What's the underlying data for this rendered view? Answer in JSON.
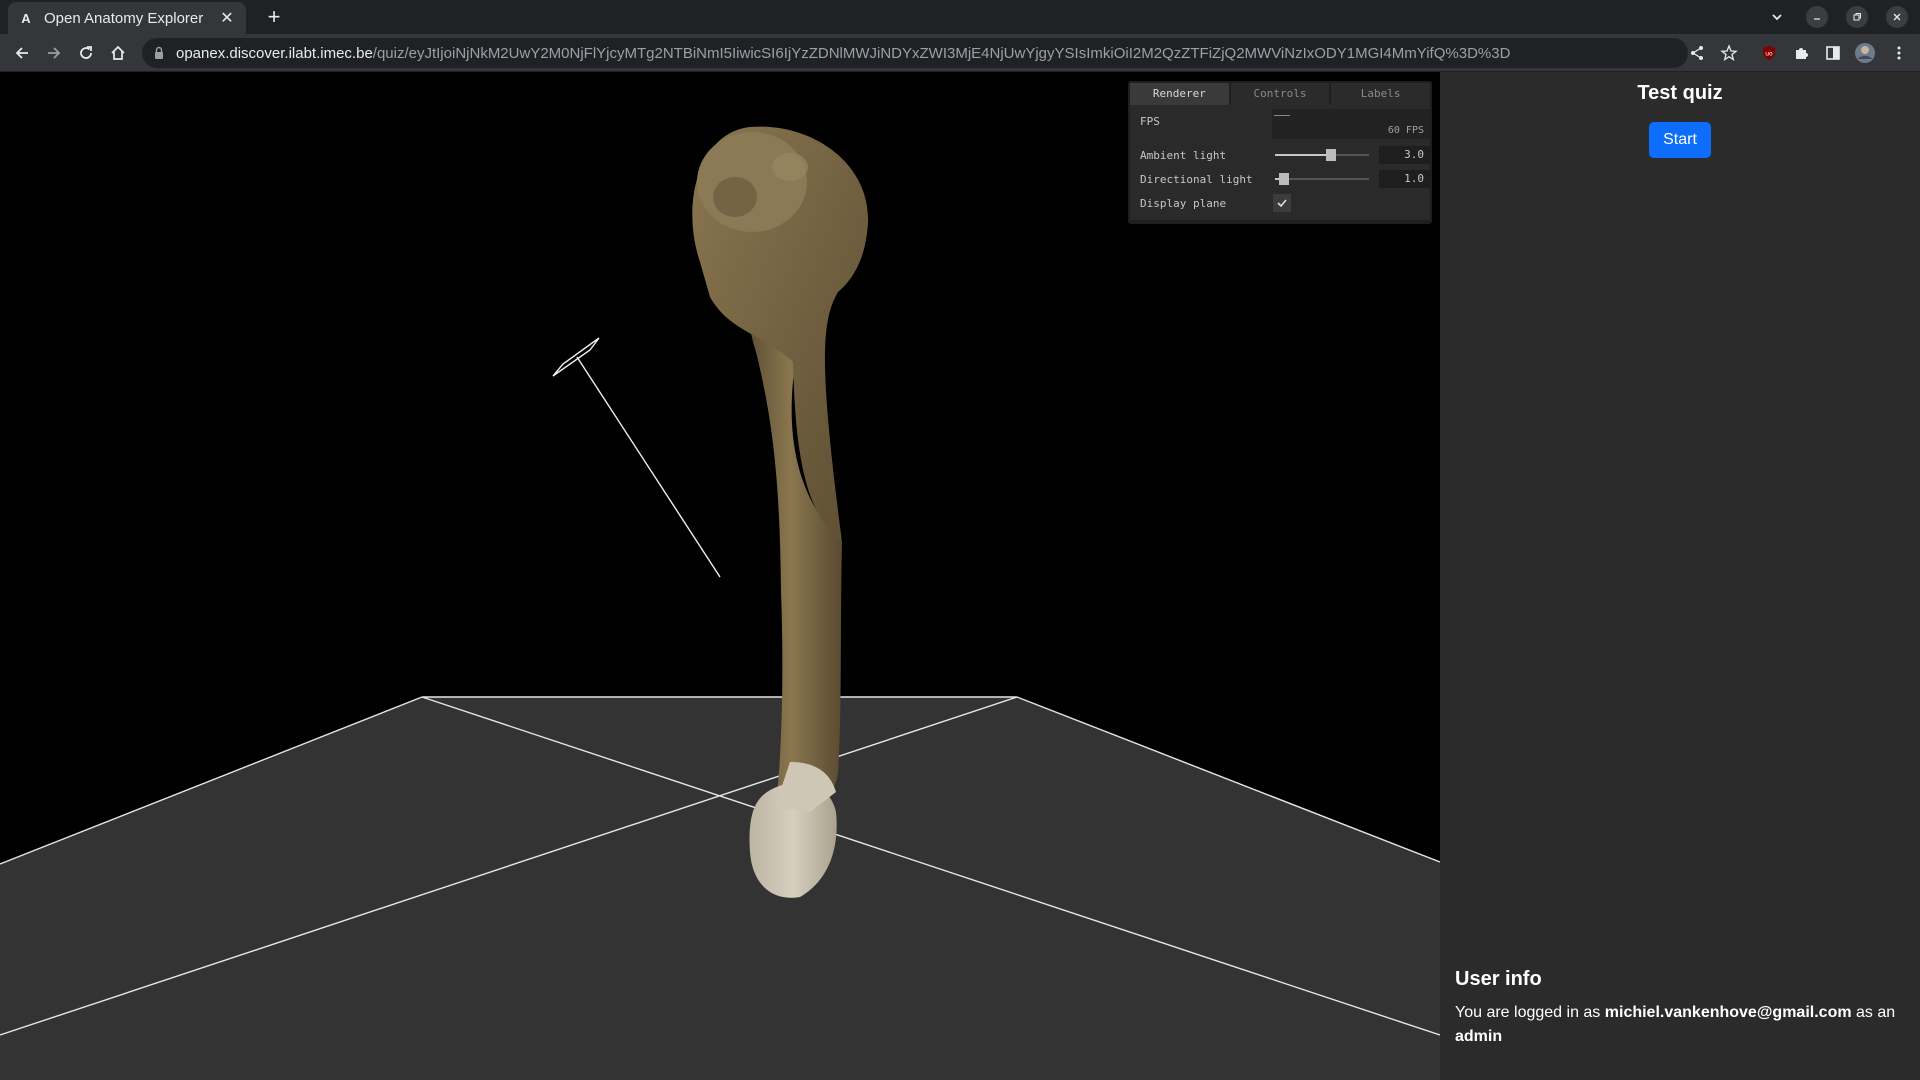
{
  "browser": {
    "tab_title": "Open Anatomy Explorer",
    "tab_favicon": "A",
    "close_glyph": "✕",
    "newtab_glyph": "+",
    "url_host": "opanex.discover.ilabt.imec.be",
    "url_path": "/quiz/eyJtIjoiNjNkM2UwY2M0NjFlYjcyMTg2NTBiNmI5IiwicSI6IjYzZDNlMWJiNDYxZWI3MjE4NjUwYjgyYSIsImkiOiI2M2QzZTFiZjQ2MWViNzIxODY1MGI4MmYifQ%3D%3D"
  },
  "gui": {
    "tabs": [
      "Renderer",
      "Controls",
      "Labels"
    ],
    "active_tab": "Renderer",
    "fps_label": "FPS",
    "fps_value": "60 FPS",
    "ambient_label": "Ambient light",
    "ambient_value": "3.0",
    "ambient_fraction": 0.6,
    "directional_label": "Directional light",
    "directional_value": "1.0",
    "directional_fraction": 0.1,
    "display_plane_label": "Display plane",
    "display_plane_checked": true
  },
  "sidebar": {
    "quiz_title": "Test quiz",
    "start_label": "Start",
    "userinfo_title": "User info",
    "userinfo_prefix": "You are logged in as",
    "userinfo_email": "michiel.vankenhove@gmail.com",
    "userinfo_middle": "as an",
    "userinfo_role": "admin"
  },
  "colors": {
    "accent": "#0d6efd",
    "bone": "#7a6848",
    "bone_light": "#c8c0ae"
  },
  "icons": [
    "back-icon",
    "forward-icon",
    "reload-icon",
    "home-icon",
    "lock-icon",
    "share-icon",
    "star-icon",
    "ublock-icon",
    "extensions-icon",
    "sidepanel-icon",
    "profile-icon",
    "menu-icon",
    "tab-search-icon",
    "minimize-icon",
    "restore-icon",
    "close-window-icon",
    "check-icon"
  ]
}
